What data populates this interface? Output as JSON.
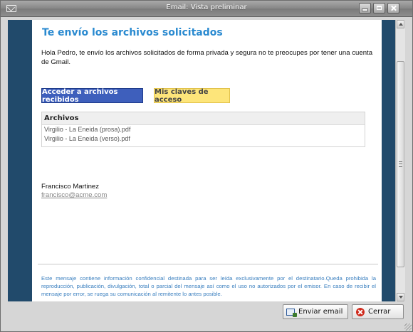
{
  "window": {
    "title": "Email: Vista preliminar"
  },
  "email": {
    "heading": "Te envío los archivos solicitados",
    "body": "Hola Pedro, te envío los archivos solicitados de forma privada y segura no te preocupes por tener una cuenta de Gmail.",
    "primary_button": "Acceder a archivos recibidos",
    "secondary_button": "Mis claves de acceso",
    "files": {
      "header": "Archivos",
      "items": [
        "Virgilio - La Eneida (prosa).pdf",
        "Virgilio - La Eneida (verso).pdf"
      ]
    },
    "signature": {
      "name": "Francisco Martinez",
      "email": "francisco@acme.com"
    },
    "disclaimer": "Este mensaje contiene información confidencial destinada para ser leída exclusivamente por el destinatario.Queda prohibida la reproducción, publicación, divulgación, total o parcial del mensaje así como el uso no autorizados por el emisor. En caso de recibir el mensaje por error, se ruega su comunicación al remitente lo antes posible."
  },
  "footer": {
    "send_label": "Enviar email",
    "close_label": "Cerrar"
  },
  "colors": {
    "heading": "#2a8ad0",
    "primary_button": "#3e5fbc",
    "secondary_button": "#fde57a",
    "preview_background": "#214a6b",
    "disclaimer": "#3a7fbf"
  }
}
